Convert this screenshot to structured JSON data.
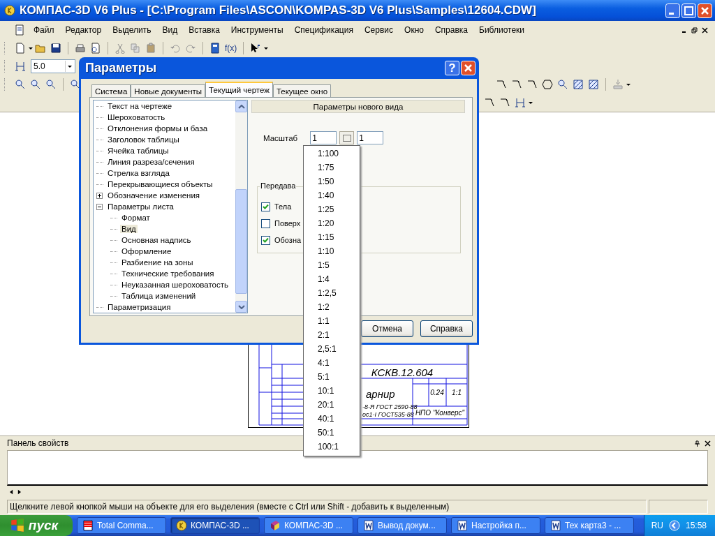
{
  "window": {
    "title": "КОМПАС-3D V6 Plus - [C:\\Program Files\\ASCON\\KOMPAS-3D V6 Plus\\Samples\\12604.CDW]"
  },
  "menu": [
    "Файл",
    "Редактор",
    "Выделить",
    "Вид",
    "Вставка",
    "Инструменты",
    "Спецификация",
    "Сервис",
    "Окно",
    "Справка",
    "Библиотеки"
  ],
  "toolbar": {
    "formula_label": "f(x)",
    "step_value": "5.0"
  },
  "drawing": {
    "designation": "КСКВ.12.604",
    "name": "арнир",
    "mass": "0.24",
    "scale": "1:1",
    "material_1": "-8-Я ГОСТ 2590-88",
    "material_2": "ос1-I ГОСТ535-88",
    "company": "НПО \"Конверс\""
  },
  "dialog": {
    "title": "Параметры",
    "help_glyph": "?",
    "tabs": [
      {
        "label": "Система",
        "selected": false
      },
      {
        "label": "Новые документы",
        "selected": false
      },
      {
        "label": "Текущий чертеж",
        "selected": true
      },
      {
        "label": "Текущее окно",
        "selected": false
      }
    ],
    "tree": [
      {
        "label": "Текст на чертеже",
        "selected": false
      },
      {
        "label": "Шероховатость",
        "selected": false
      },
      {
        "label": "Отклонения формы и база",
        "selected": false
      },
      {
        "label": "Заголовок таблицы",
        "selected": false
      },
      {
        "label": "Ячейка таблицы",
        "selected": false
      },
      {
        "label": "Линия разреза/сечения",
        "selected": false
      },
      {
        "label": "Стрелка взгляда",
        "selected": false
      },
      {
        "label": "Перекрывающиеся объекты",
        "selected": false
      },
      {
        "label": "Обозначение изменения",
        "selected": false,
        "expanded": false
      },
      {
        "label": "Параметры листа",
        "selected": false,
        "expanded": true,
        "children": [
          {
            "label": "Формат",
            "selected": false
          },
          {
            "label": "Вид",
            "selected": true
          },
          {
            "label": "Основная надпись",
            "selected": false
          },
          {
            "label": "Оформление",
            "selected": false
          },
          {
            "label": "Разбиение на зоны",
            "selected": false
          },
          {
            "label": "Технические требования",
            "selected": false
          },
          {
            "label": "Неуказанная шероховатость",
            "selected": false
          },
          {
            "label": "Таблица изменений",
            "selected": false
          }
        ]
      },
      {
        "label": "Параметризация",
        "selected": false
      }
    ],
    "section_title": "Параметры нового вида",
    "scale_label": "Масштаб",
    "scale_numerator": "1",
    "scale_denominator": "1",
    "group_legend": "Передава",
    "checkboxes": [
      {
        "label": "Тела",
        "checked": true
      },
      {
        "label": "Поверх",
        "checked": false
      },
      {
        "label": "Обозна",
        "checked": true
      }
    ],
    "buttons": [
      "Отмена",
      "Справка"
    ]
  },
  "scale_dropdown": [
    "1:100",
    "1:75",
    "1:50",
    "1:40",
    "1:25",
    "1:20",
    "1:15",
    "1:10",
    "1:5",
    "1:4",
    "1:2,5",
    "1:2",
    "1:1",
    "2:1",
    "2,5:1",
    "4:1",
    "5:1",
    "10:1",
    "20:1",
    "40:1",
    "50:1",
    "100:1"
  ],
  "properties_panel": {
    "title": "Панель свойств"
  },
  "status_bar": {
    "text": "Щелкните левой кнопкой мыши на объекте для его выделения (вместе с Ctrl или Shift - добавить к выделенным)"
  },
  "taskbar": {
    "start_label": "пуск",
    "tasks": [
      {
        "label": "Total Comma...",
        "kind": "file-manager",
        "selected": false
      },
      {
        "label": "КОМПАС-3D ...",
        "kind": "kompas",
        "selected": true
      },
      {
        "label": "КОМПАС-3D ...",
        "kind": "book",
        "selected": false
      },
      {
        "label": "Вывод докум...",
        "kind": "word",
        "selected": false
      },
      {
        "label": "Настройка п...",
        "kind": "word",
        "selected": false
      },
      {
        "label": "Тех карта3 - ...",
        "kind": "word",
        "selected": false
      }
    ],
    "language": "RU",
    "clock": "15:58"
  }
}
